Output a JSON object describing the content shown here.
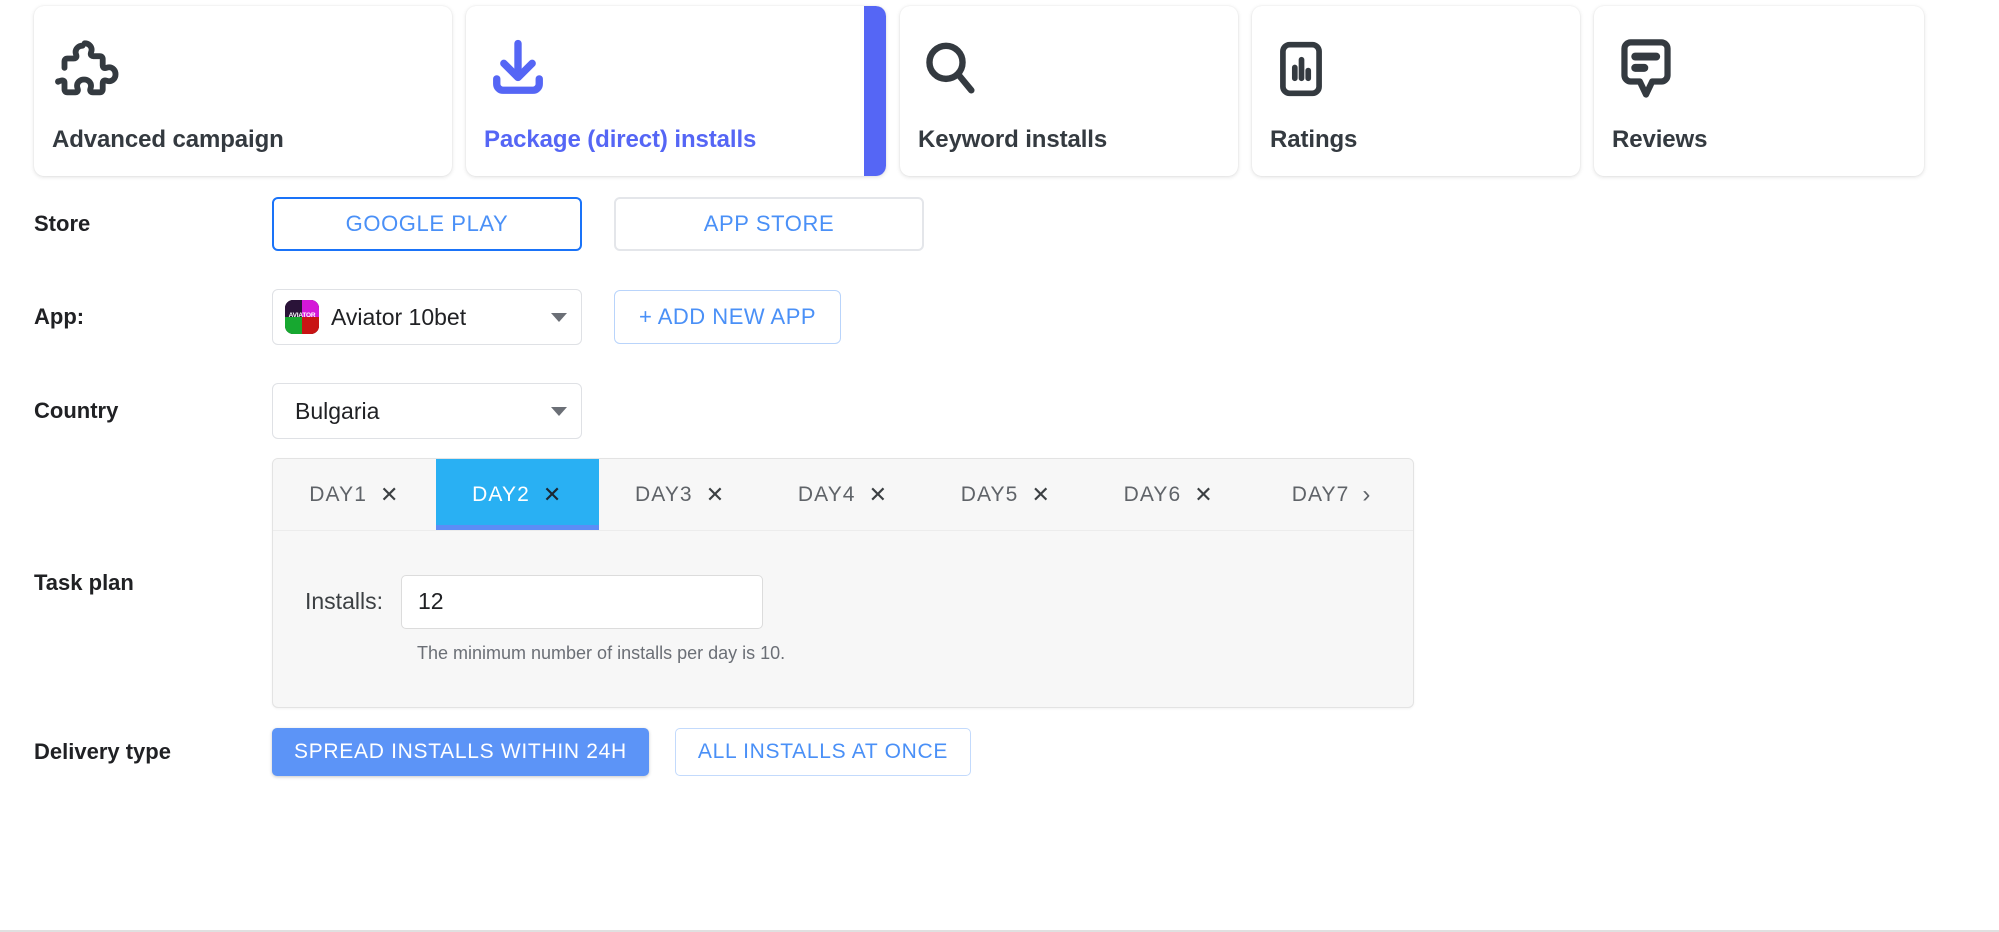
{
  "campaign_types": [
    {
      "label": "Advanced campaign",
      "icon": "puzzle-icon",
      "selected": false
    },
    {
      "label": "Package (direct) installs",
      "icon": "download-icon",
      "selected": true
    },
    {
      "label": "Keyword installs",
      "icon": "search-icon",
      "selected": false
    },
    {
      "label": "Ratings",
      "icon": "bar-chart-phone-icon",
      "selected": false
    },
    {
      "label": "Reviews",
      "icon": "comment-lines-icon",
      "selected": false
    }
  ],
  "store": {
    "label": "Store",
    "options": [
      {
        "label": "GOOGLE PLAY",
        "selected": true
      },
      {
        "label": "APP STORE",
        "selected": false
      }
    ]
  },
  "app": {
    "label": "App:",
    "selected": "Aviator 10bet",
    "icon_text": "AVIATOR",
    "add_button": "+ ADD NEW APP"
  },
  "country": {
    "label": "Country",
    "selected": "Bulgaria"
  },
  "task_plan": {
    "label": "Task plan",
    "tabs": [
      {
        "label": "DAY1",
        "closable": true,
        "active": false
      },
      {
        "label": "DAY2",
        "closable": true,
        "active": true
      },
      {
        "label": "DAY3",
        "closable": true,
        "active": false
      },
      {
        "label": "DAY4",
        "closable": true,
        "active": false
      },
      {
        "label": "DAY5",
        "closable": true,
        "active": false
      },
      {
        "label": "DAY6",
        "closable": true,
        "active": false
      },
      {
        "label": "DAY7",
        "closable": false,
        "active": false
      }
    ],
    "close_glyph": "✕",
    "next_glyph": "›",
    "installs_label": "Installs:",
    "installs_value": "12",
    "hint": "The minimum number of installs per day is 10."
  },
  "delivery": {
    "label": "Delivery type",
    "options": [
      {
        "label": "SPREAD INSTALLS WITHIN 24H",
        "selected": true
      },
      {
        "label": "ALL INSTALLS AT ONCE",
        "selected": false
      }
    ]
  },
  "colors": {
    "accent_indigo": "#5566f5",
    "accent_blue": "#4a90f7",
    "active_tab": "#29b0f3",
    "filled_button": "#5c94f7"
  }
}
